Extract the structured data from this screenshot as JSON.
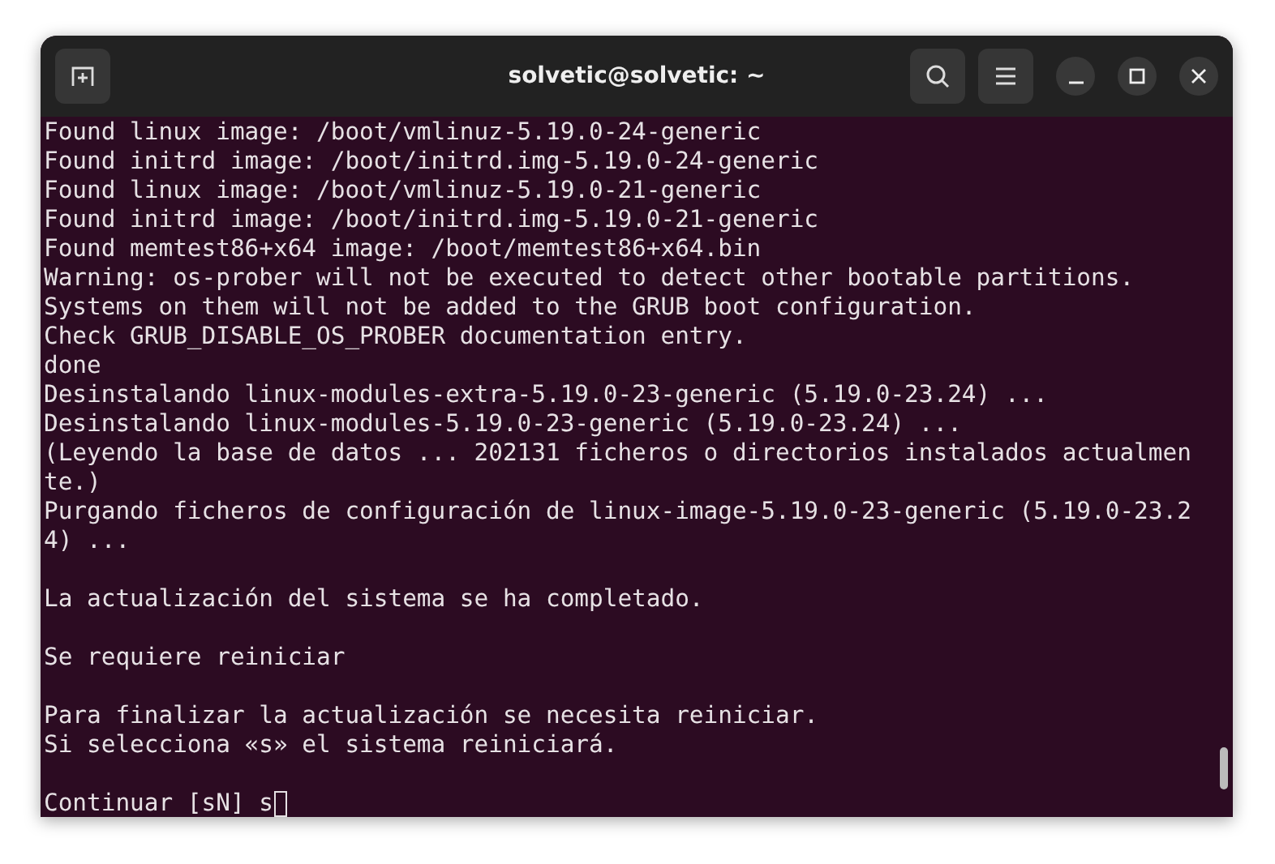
{
  "window": {
    "title": "solvetic@solvetic: ~"
  },
  "terminal": {
    "blocks": [
      [
        "Found linux image: /boot/vmlinuz-5.19.0-24-generic",
        "Found initrd image: /boot/initrd.img-5.19.0-24-generic",
        "Found linux image: /boot/vmlinuz-5.19.0-21-generic",
        "Found initrd image: /boot/initrd.img-5.19.0-21-generic",
        "Found memtest86+x64 image: /boot/memtest86+x64.bin",
        "Warning: os-prober will not be executed to detect other bootable partitions.",
        "Systems on them will not be added to the GRUB boot configuration.",
        "Check GRUB_DISABLE_OS_PROBER documentation entry.",
        "done",
        "Desinstalando linux-modules-extra-5.19.0-23-generic (5.19.0-23.24) ...",
        "Desinstalando linux-modules-5.19.0-23-generic (5.19.0-23.24) ...",
        "(Leyendo la base de datos ... 202131 ficheros o directorios instalados actualmen",
        "te.)",
        "Purgando ficheros de configuración de linux-image-5.19.0-23-generic (5.19.0-23.2",
        "4) ..."
      ],
      [
        "La actualización del sistema se ha completado."
      ],
      [
        "Se requiere reiniciar"
      ],
      [
        "Para finalizar la actualización se necesita reiniciar.",
        "Si selecciona «s» el sistema reiniciará."
      ]
    ],
    "prompt": "Continuar [sN] s"
  }
}
